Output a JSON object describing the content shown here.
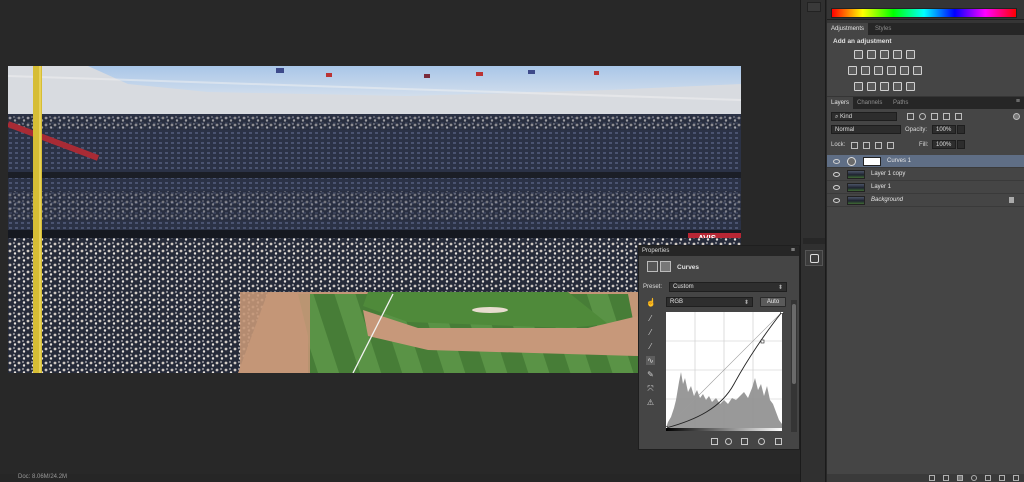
{
  "status_bar": {
    "doc_info": "Doc: 8.06M/24.2M"
  },
  "adjustments_panel": {
    "tabs": [
      {
        "label": "Adjustments",
        "active": true
      },
      {
        "label": "Styles",
        "active": false
      }
    ],
    "title": "Add an adjustment"
  },
  "layers_panel": {
    "tabs": [
      {
        "label": "Layers",
        "active": true
      },
      {
        "label": "Channels",
        "active": false
      },
      {
        "label": "Paths",
        "active": false
      }
    ],
    "filter_kind": "Kind",
    "blend_mode": "Normal",
    "opacity_label": "Opacity:",
    "opacity_value": "100%",
    "lock_label": "Lock:",
    "fill_label": "Fill:",
    "fill_value": "100%",
    "layers": [
      {
        "name": "Curves 1",
        "type": "adjustment",
        "selected": true
      },
      {
        "name": "Layer 1 copy",
        "type": "pixel",
        "selected": false
      },
      {
        "name": "Layer 1",
        "type": "pixel",
        "selected": false
      },
      {
        "name": "Background",
        "type": "background",
        "selected": false,
        "locked": true
      }
    ]
  },
  "properties_panel": {
    "title": "Properties",
    "adjustment_name": "Curves",
    "preset_label": "Preset:",
    "preset_value": "Custom",
    "channel_value": "RGB",
    "auto_label": "Auto"
  },
  "photo": {
    "sign_text": "AVIS",
    "colors": {
      "sky": "#8fb4de",
      "field_grass": "#4f8a3a",
      "infield_dirt": "#c7987a",
      "foul_pole": "#d9c23a",
      "seats": "#2a3146"
    }
  },
  "colors": {
    "panel_bg": "#454545",
    "dock_bg": "#353535",
    "workspace": "#282828",
    "selected_layer": "#5f6e85"
  },
  "curve": {
    "points": [
      [
        0,
        0
      ],
      [
        96,
        60
      ],
      [
        255,
        255
      ]
    ]
  }
}
